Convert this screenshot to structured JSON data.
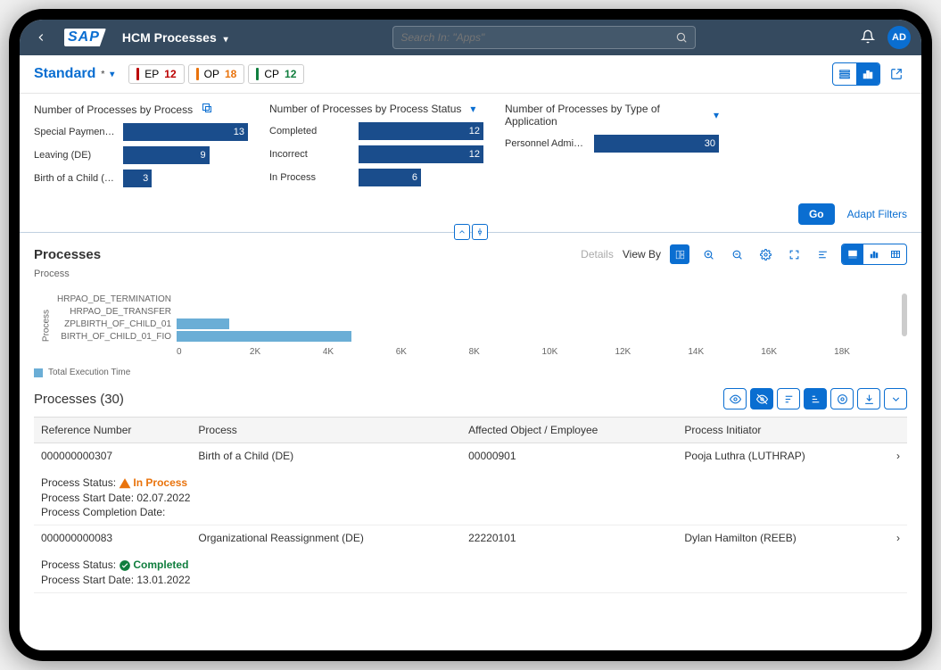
{
  "shell": {
    "app_title": "HCM Processes",
    "search_placeholder": "Search In: \"Apps\"",
    "avatar": "AD"
  },
  "toolbar": {
    "variant": "Standard",
    "chips": [
      {
        "label": "EP",
        "value": "12",
        "color": "red"
      },
      {
        "label": "OP",
        "value": "18",
        "color": "orange"
      },
      {
        "label": "CP",
        "value": "12",
        "color": "green"
      }
    ]
  },
  "filters": [
    {
      "title": "Number of Processes by Process",
      "expand_icon": "popout",
      "bars": [
        {
          "label": "Special Paymen…",
          "value": 13,
          "max": 13
        },
        {
          "label": "Leaving (DE)",
          "value": 9,
          "max": 13
        },
        {
          "label": "Birth of a Child (…",
          "value": 3,
          "max": 13
        }
      ]
    },
    {
      "title": "Number of Processes by Process Status",
      "expand_icon": "chevron",
      "bars": [
        {
          "label": "Completed",
          "value": 12,
          "max": 12
        },
        {
          "label": "Incorrect",
          "value": 12,
          "max": 12
        },
        {
          "label": "In Process",
          "value": 6,
          "max": 12
        }
      ]
    },
    {
      "title": "Number of Processes by Type of Application",
      "expand_icon": "chevron",
      "bars": [
        {
          "label": "Personnel Admi…",
          "value": 30,
          "max": 30
        }
      ]
    }
  ],
  "filter_footer": {
    "go": "Go",
    "adapt": "Adapt Filters"
  },
  "chart_section": {
    "title": "Processes",
    "subtitle": "Process",
    "details": "Details",
    "view_by": "View By"
  },
  "chart_data": {
    "type": "bar",
    "orientation": "horizontal",
    "ylabel": "Process",
    "legend": "Total Execution Time",
    "x_ticks": [
      "0",
      "2K",
      "4K",
      "6K",
      "8K",
      "10K",
      "12K",
      "14K",
      "16K",
      "18K"
    ],
    "x_max": 18000,
    "series": [
      {
        "label": "HRPAO_DE_TERMINATION",
        "value": 0
      },
      {
        "label": "HRPAO_DE_TRANSFER",
        "value": 0
      },
      {
        "label": "ZPLBIRTH_OF_CHILD_01",
        "value": 1300
      },
      {
        "label": "BIRTH_OF_CHILD_01_FIO",
        "value": 4300
      }
    ]
  },
  "table": {
    "title": "Processes (30)",
    "columns": [
      "Reference Number",
      "Process",
      "Affected Object / Employee",
      "Process Initiator",
      ""
    ],
    "status_label": "Process Status:",
    "start_label": "Process Start Date:",
    "comp_label": "Process Completion Date:",
    "rows": [
      {
        "ref": "000000000307",
        "process": "Birth of a Child (DE)",
        "object": "00000901",
        "initiator": "Pooja Luthra (LUTHRAP)",
        "status": "In Process",
        "status_kind": "inproc",
        "start": "02.07.2022",
        "comp": ""
      },
      {
        "ref": "000000000083",
        "process": "Organizational Reassignment (DE)",
        "object": "22220101",
        "initiator": "Dylan Hamilton (REEB)",
        "status": "Completed",
        "status_kind": "comp",
        "start": "13.01.2022",
        "comp": ""
      }
    ]
  }
}
